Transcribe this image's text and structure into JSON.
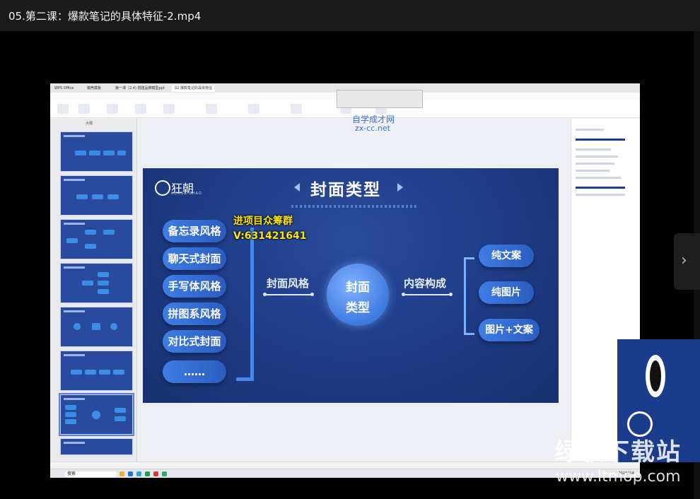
{
  "window": {
    "title": "05.第二课：爆款笔记的具体特征-2.mp4"
  },
  "screen": {
    "tabs": [
      "WPS Office",
      "稿壳模板",
      "第一课（2.4)  搭建品牌模型ppt",
      "02 爆款笔记的具体特征"
    ],
    "panel_label": "大纲",
    "taskbar": {
      "search": "搜索",
      "time": "2023/2/4"
    },
    "watermark": {
      "cn": "自学成才网",
      "url": "zx-cc.net"
    }
  },
  "slide": {
    "logo": "狂朝",
    "logo_sub": "KUANG CHAO",
    "title": "封面类型",
    "left_items": [
      "备忘录风格",
      "聊天式封面",
      "手写体风格",
      "拼图系风格",
      "对比式封面",
      "……"
    ],
    "left_label": "封面风格",
    "center_line1": "封面",
    "center_line2": "类型",
    "right_label": "内容构成",
    "right_items": [
      "纯文案",
      "纯图片",
      "图片+文案"
    ]
  },
  "overlay": {
    "line1": "进项目众筹群",
    "line2": "V:631421641"
  },
  "site": {
    "cn": "绿软下载站",
    "url": "www.ltmop.com"
  },
  "colors": {
    "slide_bg": "#1d3a82",
    "pill": "#3a75e0",
    "overlay_text": "#ffe600"
  }
}
